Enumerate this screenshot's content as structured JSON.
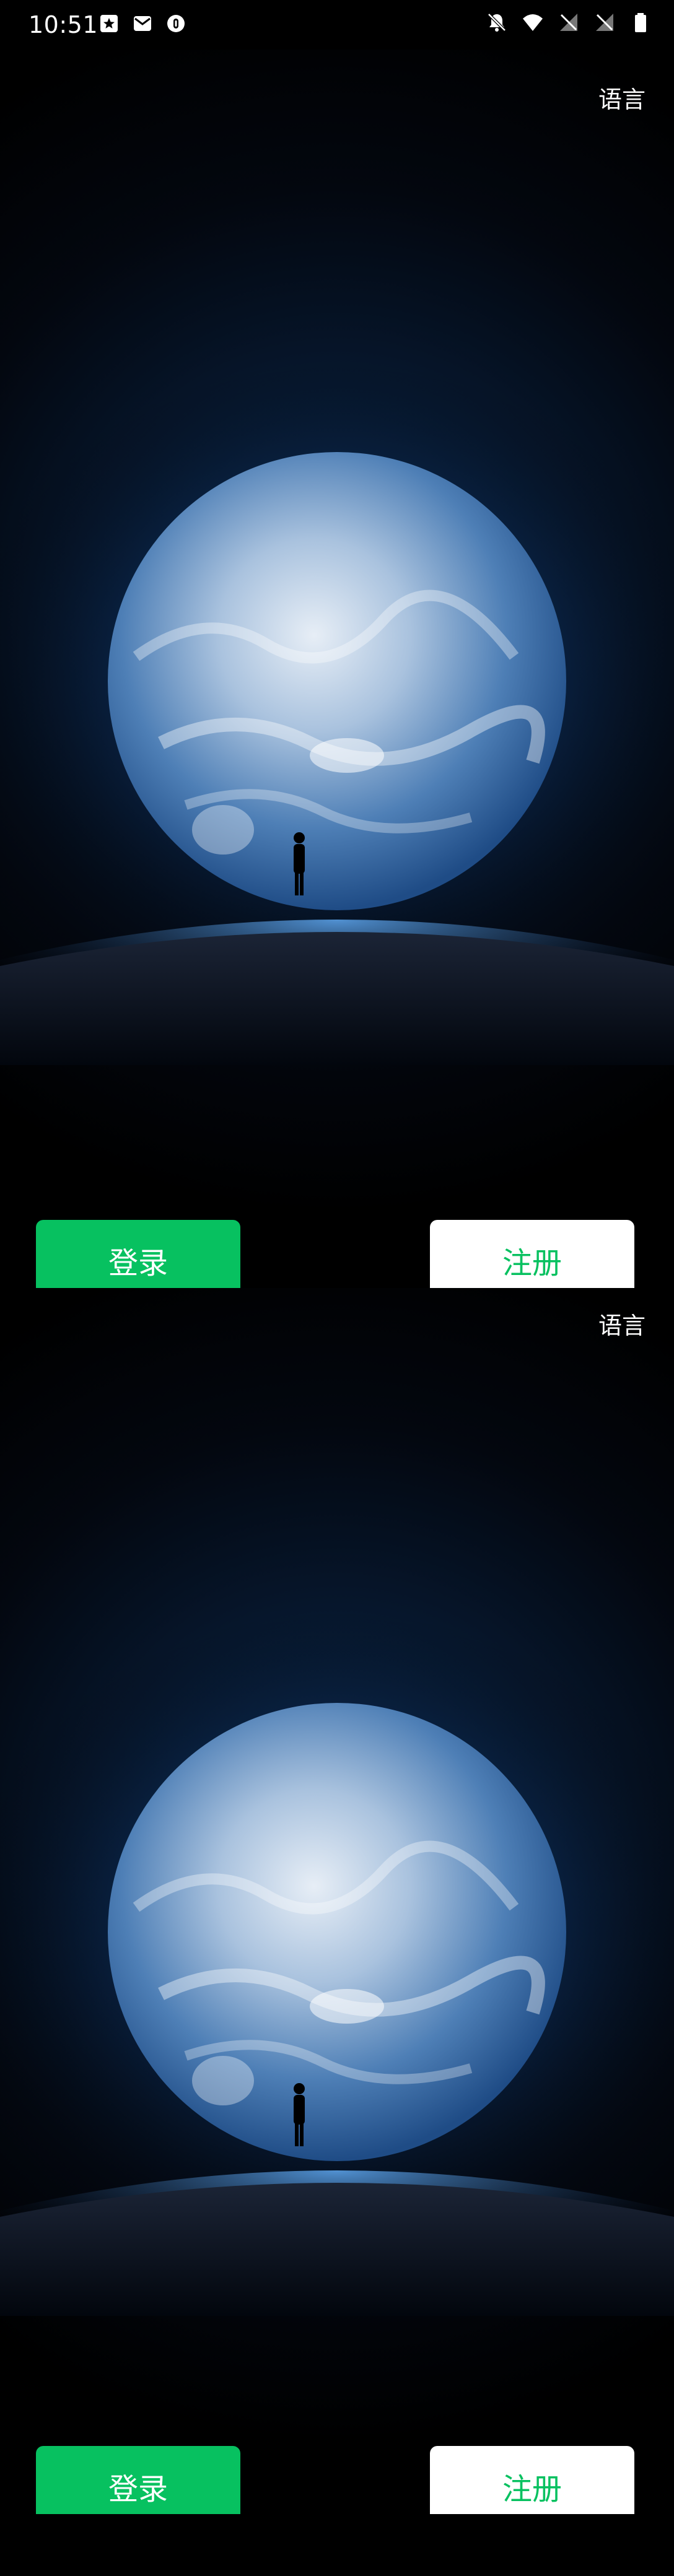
{
  "status_bar": {
    "time": "10:51",
    "left_icons": [
      "star-notification-icon",
      "mail-icon",
      "shield-icon"
    ],
    "right_icons": [
      "mute-bell-icon",
      "wifi-icon",
      "no-sim-icon",
      "no-sim-icon",
      "battery-icon"
    ]
  },
  "screens": [
    {
      "language_label": "语言",
      "login_label": "登录",
      "register_label": "注册"
    },
    {
      "language_label": "语言",
      "login_label": "登录",
      "register_label": "注册"
    }
  ],
  "colors": {
    "accent_green": "#07c160",
    "background_dark": "#02060d",
    "status_bar": "#000000",
    "text_white": "#ffffff"
  }
}
